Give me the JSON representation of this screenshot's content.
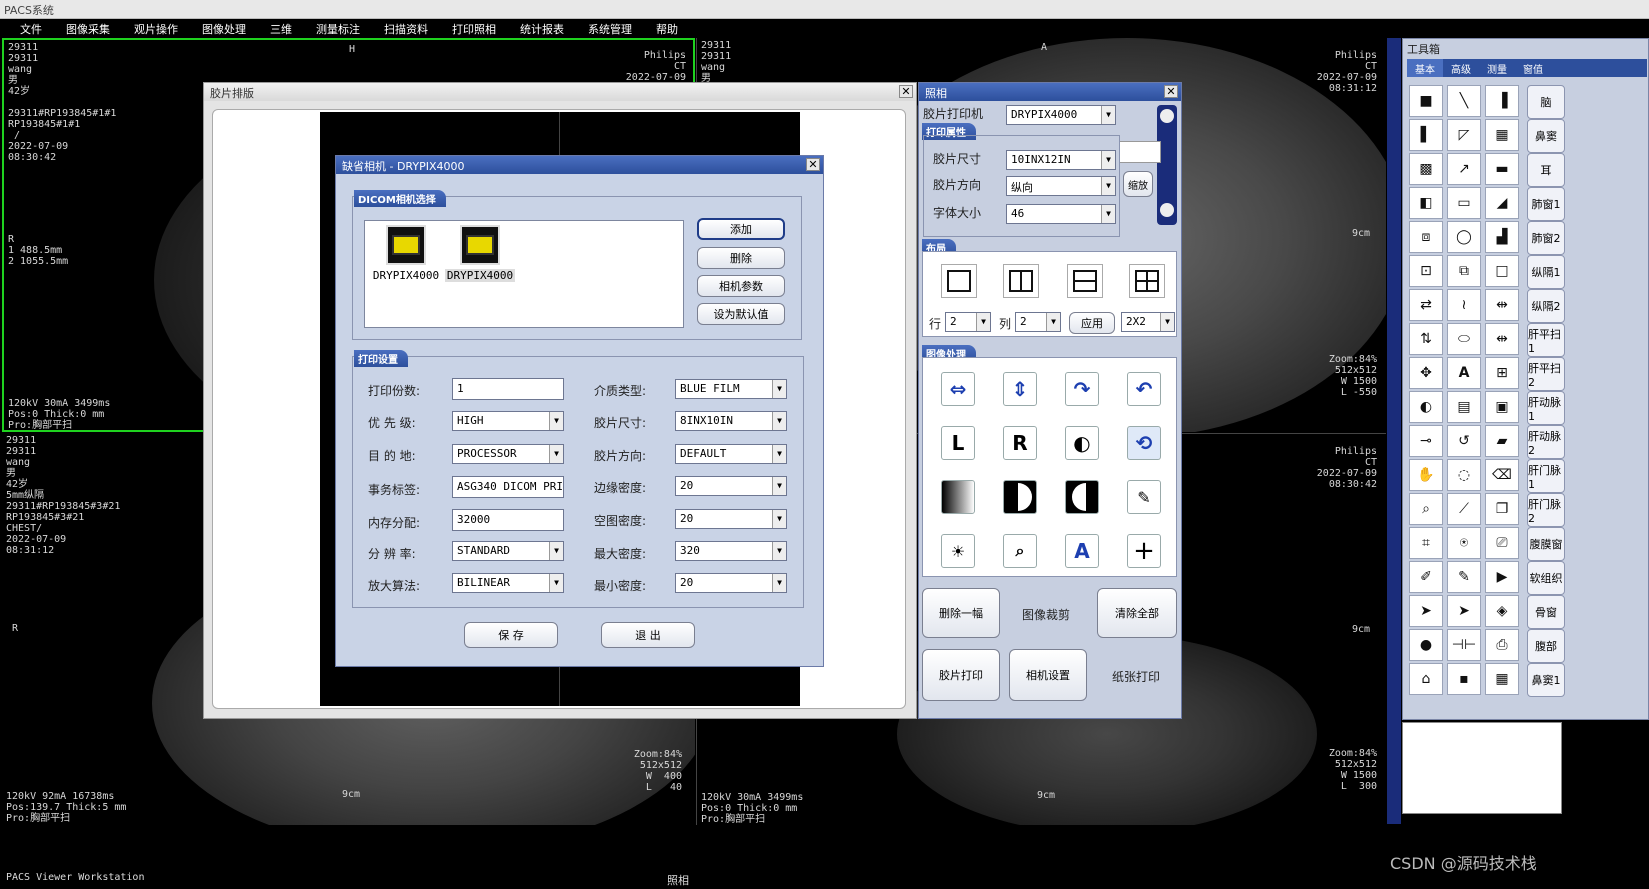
{
  "app": {
    "title": "PACS系统",
    "status": "PACS Viewer Workstation",
    "status_center": "照相"
  },
  "menu": [
    "文件",
    "图像采集",
    "观片操作",
    "图像处理",
    "三维",
    "测量标注",
    "扫描资料",
    "打印照相",
    "统计报表",
    "系统管理",
    "帮助"
  ],
  "viewports": {
    "tl": {
      "left": "29311\n29311\nwang\n男\n42岁\n\n29311#RP193845#1#1\nRP193845#1#1\n /\n2022-07-09\n08:30:42",
      "top": "H",
      "right": "Philips\nCT\n2022-07-09",
      "mid": "R\n1 488.5mm\n2 1055.5mm",
      "bottom": "120kV 30mA 3499ms\nPos:0 Thick:0 mm\nPro:胸部平扫"
    },
    "tr": {
      "left": "29311\n29311\nwang\n男",
      "top": "A",
      "right": "Philips\nCT\n2022-07-09\n08:31:12",
      "scale": "9cm",
      "zoom": "Zoom:84%\n512x512\nW 1500\nL -550"
    },
    "bl": {
      "left": "29311\n29311\nwang\n男\n42岁\n5mm纵隔\n29311#RP193845#3#21\nRP193845#3#21\nCHEST/\n2022-07-09\n08:31:12",
      "mid": "R",
      "zoom": "Zoom:84%\n512x512\nW  400\nL   40",
      "scale": "9cm",
      "bottom": "120kV 92mA 16738ms\nPos:139.7 Thick:5 mm\nPro:胸部平扫"
    },
    "br": {
      "right": "Philips\nCT\n2022-07-09\n08:30:42",
      "scale": "9cm",
      "scale2": "9cm",
      "zoom": "Zoom:84%\n512x512\nW 1500\nL  300",
      "bottom": "120kV 30mA 3499ms\nPos:0 Thick:0 mm\nPro:胸部平扫"
    }
  },
  "film_layout": {
    "title": "胶片排版"
  },
  "camera_dialog": {
    "title": "缺省相机 - DRYPIX4000",
    "group_select": "DICOM相机选择",
    "cameras": [
      "DRYPIX4000",
      "DRYPIX4000"
    ],
    "buttons": {
      "add": "添加",
      "delete": "删除",
      "params": "相机参数",
      "set_default": "设为默认值",
      "save": "保 存",
      "exit": "退 出"
    },
    "group_print": "打印设置",
    "left_fields": [
      {
        "label": "打印份数:",
        "value": "1",
        "kind": "field"
      },
      {
        "label": "优 先 级:",
        "value": "HIGH",
        "kind": "combo"
      },
      {
        "label": "目 的 地:",
        "value": "PROCESSOR",
        "kind": "combo"
      },
      {
        "label": "事务标签:",
        "value": "ASG340 DICOM PRI",
        "kind": "field"
      },
      {
        "label": "内存分配:",
        "value": "32000",
        "kind": "field"
      },
      {
        "label": "分 辨 率:",
        "value": "STANDARD",
        "kind": "combo"
      },
      {
        "label": "放大算法:",
        "value": "BILINEAR",
        "kind": "combo"
      }
    ],
    "right_fields": [
      {
        "label": "介质类型:",
        "value": "BLUE FILM"
      },
      {
        "label": "胶片尺寸:",
        "value": "8INX10IN"
      },
      {
        "label": "胶片方向:",
        "value": "DEFAULT"
      },
      {
        "label": "边缘密度:",
        "value": "20"
      },
      {
        "label": "空图密度:",
        "value": "20"
      },
      {
        "label": "最大密度:",
        "value": "320"
      },
      {
        "label": "最小密度:",
        "value": "20"
      }
    ]
  },
  "photo_panel": {
    "title": "照相",
    "printer_label": "胶片打印机",
    "printer_value": "DRYPIX4000",
    "group_props": "打印属性",
    "film_size_label": "胶片尺寸",
    "film_size_value": "10INX12IN",
    "film_dir_label": "胶片方向",
    "film_dir_value": "纵向",
    "font_label": "字体大小",
    "font_value": "46",
    "thumb_btn": "缩放",
    "group_layout": "布局",
    "rows_label": "行",
    "rows_value": "2",
    "cols_label": "列",
    "cols_value": "2",
    "apply": "应用",
    "grid_value": "2X2",
    "group_image": "图像处理",
    "btn_delete_one": "删除一幅",
    "btn_crop": "图像裁剪",
    "btn_clear_all": "清除全部",
    "btn_film_print": "胶片打印",
    "btn_camera_settings": "相机设置",
    "btn_paper_print": "纸张打印"
  },
  "toolbox": {
    "title": "工具箱",
    "tabs": [
      "基本",
      "高级",
      "测量",
      "窗值"
    ],
    "presets": [
      "脑",
      "鼻窦",
      "耳",
      "肺窗1",
      "肺窗2",
      "纵隔1",
      "纵隔2",
      "肝平扫1",
      "肝平扫2",
      "肝动脉1",
      "肝动脉2",
      "肝门脉1",
      "肝门脉2",
      "腹膜窗",
      "软组织",
      "骨窗",
      "腹部",
      "鼻窦1"
    ]
  },
  "watermark": "CSDN @源码技术栈"
}
